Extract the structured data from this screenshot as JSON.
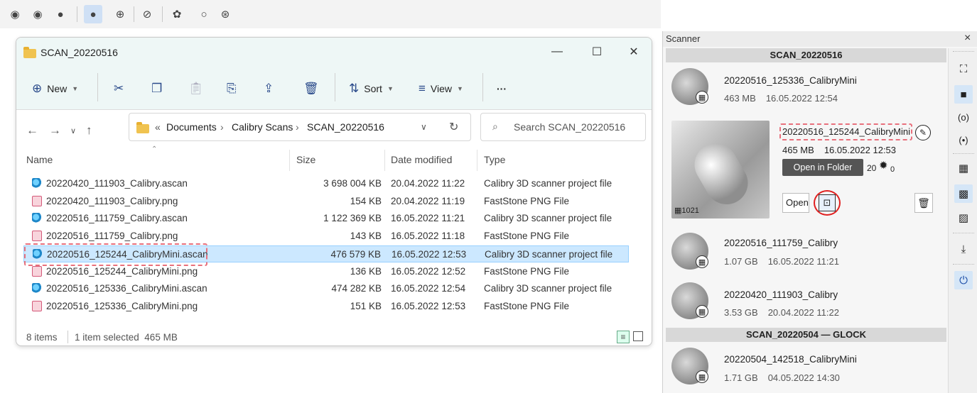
{
  "toolbar": {
    "icons": [
      "view-mode-1-icon",
      "view-mode-2-icon",
      "view-mode-3-icon",
      "sphere-solid-icon",
      "sphere-grid-icon",
      "no-texture-icon",
      "brain-mesh-icon",
      "circle-icon",
      "target-icon"
    ]
  },
  "explorer": {
    "title": "SCAN_20220516",
    "window_controls": {
      "minimize": "—",
      "maximize": "☐",
      "close": "✕"
    },
    "commands": {
      "new": "New",
      "sort": "Sort",
      "view": "View",
      "more": "···"
    },
    "address": {
      "prefix": "«",
      "parts": [
        "Documents",
        "Calibry Scans",
        "SCAN_20220516"
      ],
      "sep": "›"
    },
    "search_placeholder": "Search SCAN_20220516",
    "columns": {
      "name": "Name",
      "size": "Size",
      "date": "Date modified",
      "type": "Type"
    },
    "files": [
      {
        "name": "20220420_111903_Calibry.ascan",
        "size": "3 698 004 KB",
        "date": "20.04.2022 11:22",
        "type": "Calibry 3D scanner project file",
        "kind": "scan"
      },
      {
        "name": "20220420_111903_Calibry.png",
        "size": "154 KB",
        "date": "20.04.2022 11:19",
        "type": "FastStone PNG File",
        "kind": "png"
      },
      {
        "name": "20220516_111759_Calibry.ascan",
        "size": "1 122 369 KB",
        "date": "16.05.2022 11:21",
        "type": "Calibry 3D scanner project file",
        "kind": "scan"
      },
      {
        "name": "20220516_111759_Calibry.png",
        "size": "143 KB",
        "date": "16.05.2022 11:18",
        "type": "FastStone PNG File",
        "kind": "png"
      },
      {
        "name": "20220516_125244_CalibryMini.ascan",
        "size": "476 579 KB",
        "date": "16.05.2022 12:53",
        "type": "Calibry 3D scanner project file",
        "kind": "scan"
      },
      {
        "name": "20220516_125244_CalibryMini.png",
        "size": "136 KB",
        "date": "16.05.2022 12:52",
        "type": "FastStone PNG File",
        "kind": "png"
      },
      {
        "name": "20220516_125336_CalibryMini.ascan",
        "size": "474 282 KB",
        "date": "16.05.2022 12:54",
        "type": "Calibry 3D scanner project file",
        "kind": "scan"
      },
      {
        "name": "20220516_125336_CalibryMini.png",
        "size": "151 KB",
        "date": "16.05.2022 12:53",
        "type": "FastStone PNG File",
        "kind": "png"
      }
    ],
    "selected_index": 4,
    "status": {
      "count": "8 items",
      "selection": "1 item selected  465 MB"
    }
  },
  "scanner": {
    "title": "Scanner",
    "close": "×",
    "group1": "SCAN_20220516",
    "group2": "SCAN_20220504 — GLOCK",
    "items": [
      {
        "name": "20220516_125336_CalibryMini",
        "size": "463 MB",
        "date": "16.05.2022 12:54"
      },
      {
        "name": "20220516_111759_Calibry",
        "size": "1.07 GB",
        "date": "16.05.2022 11:21"
      },
      {
        "name": "20220420_111903_Calibry",
        "size": "3.53 GB",
        "date": "20.04.2022 11:22"
      },
      {
        "name": "20220504_142518_CalibryMini",
        "size": "1.71 GB",
        "date": "04.05.2022 14:30"
      }
    ],
    "expanded": {
      "name": "20220516_125244_CalibryMini",
      "size": "465 MB",
      "date": "16.05.2022 12:53",
      "frames": "1021",
      "count_a": "20",
      "count_b": "0",
      "open_label": "Open",
      "tooltip": "Open in Folder"
    }
  }
}
